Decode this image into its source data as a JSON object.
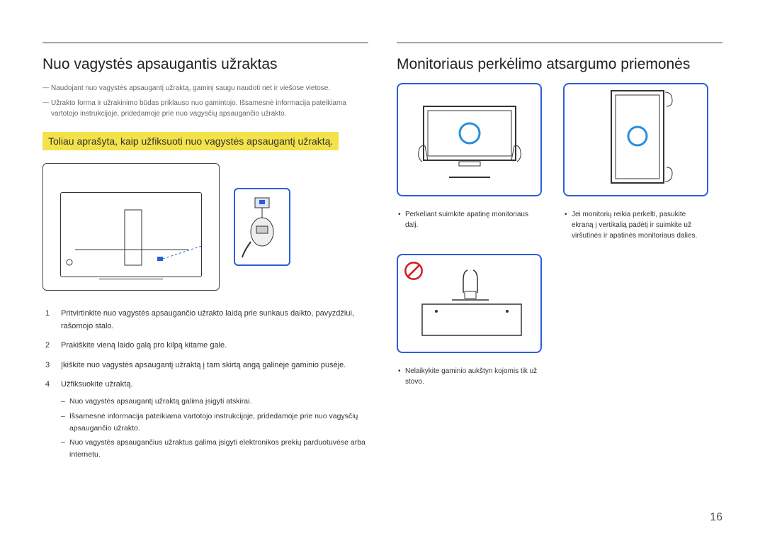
{
  "page_number": "16",
  "left": {
    "title": "Nuo vagystės apsaugantis užraktas",
    "footnotes": [
      "Naudojant nuo vagystės apsaugantį užraktą, gaminį saugu naudoti net ir viešose vietose.",
      "Užrakto forma ir užrakinimo būdas priklauso nuo gamintojo. Išsamesnė informacija pateikiama vartotojo instrukcijoje, pridedamoje prie nuo vagysčių apsaugančio užrakto."
    ],
    "highlight": "Toliau aprašyta, kaip užfiksuoti nuo vagystės apsaugantį užraktą.",
    "steps": [
      "Pritvirtinkite nuo vagystės apsaugančio užrakto laidą prie sunkaus daikto, pavyzdžiui, rašomojo stalo.",
      "Prakiškite vieną laido galą pro kilpą kitame gale.",
      "Įkiškite nuo vagystės apsaugantį užraktą į tam skirtą angą galinėje gaminio pusėje.",
      "Užfiksuokite užraktą."
    ],
    "substeps": [
      "Nuo vagystės apsaugantį užraktą galima įsigyti atskirai.",
      "Išsamesnė informacija pateikiama vartotojo instrukcijoje, pridedamoje prie nuo vagysčių apsaugančio užrakto.",
      "Nuo vagystės apsaugančius užraktus galima įsigyti elektronikos prekių parduotuvėse arba internetu."
    ]
  },
  "right": {
    "title": "Monitoriaus perkėlimo atsargumo priemonės",
    "caption1": "Perkeliant suimkite apatinę monitoriaus dalį.",
    "caption2": "Jei monitorių reikia perkelti, pasukite ekraną į vertikalią padėtį ir suimkite už viršutinės ir apatinės monitoriaus dalies.",
    "caption3": "Nelaikykite gaminio aukštyn kojomis tik už stovo."
  }
}
